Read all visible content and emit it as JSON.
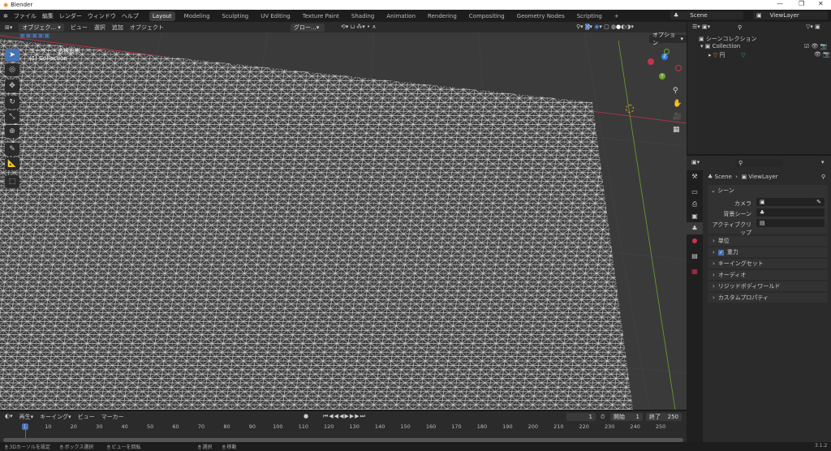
{
  "window": {
    "title": "Blender",
    "min": "—",
    "max": "❐",
    "close": "✕"
  },
  "menu": {
    "items": [
      "ファイル",
      "編集",
      "レンダー",
      "ウィンドウ",
      "ヘルプ"
    ],
    "workspaces": [
      "Layout",
      "Modeling",
      "Sculpting",
      "UV Editing",
      "Texture Paint",
      "Shading",
      "Animation",
      "Rendering",
      "Compositing",
      "Geometry Nodes",
      "Scripting",
      "+"
    ],
    "scene": "Scene",
    "view_layer": "ViewLayer"
  },
  "viewport": {
    "mode": "オブジェク...",
    "menus": [
      "ビュー",
      "選択",
      "追加",
      "オブジェクト"
    ],
    "transform": "グロー...",
    "options": "オプション",
    "overlay_title": "ユーザー・透視投影",
    "overlay_sub": "(1) Collection",
    "gizmo": {
      "x": "X",
      "y": "Y",
      "z": "Z"
    }
  },
  "outliner": {
    "root": "シーンコレクション",
    "collection": "Collection",
    "object": "円"
  },
  "properties": {
    "breadcrumb_scene": "Scene",
    "breadcrumb_layer": "ViewLayer",
    "section": "シーン",
    "fields": [
      {
        "label": "カメラ",
        "value": ""
      },
      {
        "label": "背景シーン",
        "value": ""
      },
      {
        "label": "アクティブクリップ",
        "value": ""
      }
    ],
    "panels": [
      "単位",
      "重力",
      "キーイングセット",
      "オーディオ",
      "リジッドボディワールド",
      "カスタムプロパティ"
    ]
  },
  "timeline": {
    "menus": [
      "再生",
      "キーイング",
      "ビュー",
      "マーカー"
    ],
    "current": "1",
    "start_label": "開始",
    "start": "1",
    "end_label": "終了",
    "end": "250",
    "ticks": [
      "1",
      "10",
      "20",
      "30",
      "40",
      "50",
      "60",
      "70",
      "80",
      "90",
      "100",
      "110",
      "120",
      "130",
      "140",
      "150",
      "160",
      "170",
      "180",
      "190",
      "200",
      "210",
      "220",
      "230",
      "240",
      "250"
    ]
  },
  "status": {
    "items": [
      "3Dカーソルを設定",
      "ボックス選択",
      "ビューを回転",
      "選択",
      "移動"
    ],
    "version": "3.1.2"
  },
  "colors": {
    "accent": "#4772b3",
    "x_axis": "#c8334a",
    "y_axis": "#6ba32c",
    "z_axis": "#2f83e0"
  }
}
